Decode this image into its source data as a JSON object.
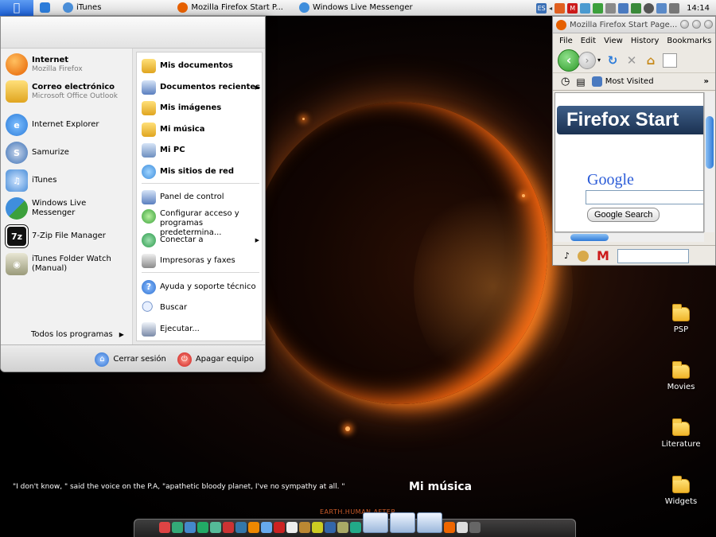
{
  "topbar": {
    "items": [
      {
        "label": "iTunes",
        "color": "#4a8ed8"
      },
      {
        "label": "Mozilla Firefox Start P...",
        "color": "#e66000"
      },
      {
        "label": "Windows Live Messenger",
        "color": "#3f8edc"
      }
    ],
    "tray_badges": [
      "ES",
      "M"
    ],
    "clock": "14:14"
  },
  "start_menu": {
    "pinned": [
      {
        "title": "Internet",
        "subtitle": "Mozilla Firefox",
        "icon": "firefox-icon",
        "color": "#e66000"
      },
      {
        "title": "Correo electrónico",
        "subtitle": "Microsoft Office Outlook",
        "icon": "outlook-icon",
        "color": "#e0a520"
      }
    ],
    "recent": [
      {
        "label": "Internet Explorer",
        "icon": "ie-icon",
        "color": "#2b7bd9"
      },
      {
        "label": "Samurize",
        "icon": "samurize-icon",
        "color": "#3a6fb5"
      },
      {
        "label": "iTunes",
        "icon": "itunes-icon",
        "color": "#4a8ed8"
      },
      {
        "label": "Windows Live Messenger",
        "icon": "messenger-icon",
        "color": "#3ca03c"
      },
      {
        "label": "7-Zip File Manager",
        "icon": "7zip-icon",
        "color": "#111111",
        "text": "7z"
      },
      {
        "label": "iTunes Folder Watch (Manual)",
        "icon": "folder-watch-icon",
        "color": "#9a9a7a"
      }
    ],
    "all_programs": "Todos los programas",
    "places": [
      {
        "label": "Mis documentos",
        "bold": true,
        "icon": "documents-folder-icon",
        "color": "#f0c040"
      },
      {
        "label": "Documentos recientes",
        "bold": true,
        "icon": "recent-documents-icon",
        "color": "#5a7fbf",
        "submenu": true
      },
      {
        "label": "Mis imágenes",
        "bold": true,
        "icon": "pictures-folder-icon",
        "color": "#f0c040"
      },
      {
        "label": "Mi música",
        "bold": true,
        "icon": "music-folder-icon",
        "color": "#f0c040"
      },
      {
        "label": "Mi PC",
        "bold": true,
        "icon": "computer-icon",
        "color": "#6d8fbf"
      },
      {
        "label": "Mis sitios de red",
        "bold": true,
        "icon": "network-icon",
        "color": "#3f8edc"
      },
      {
        "label": "Panel de control",
        "icon": "control-panel-icon",
        "color": "#5a7fbf"
      },
      {
        "label": "Configurar acceso y programas predetermina...",
        "icon": "default-programs-icon",
        "color": "#3aa23a"
      },
      {
        "label": "Conectar a",
        "icon": "connect-icon",
        "color": "#2a9a4a",
        "submenu": true
      },
      {
        "label": "Impresoras y faxes",
        "icon": "printer-icon",
        "color": "#8a8a8a"
      },
      {
        "label": "Ayuda y soporte técnico",
        "icon": "help-icon",
        "color": "#2b6fd0"
      },
      {
        "label": "Buscar",
        "icon": "search-icon",
        "color": "#5a7fbf"
      },
      {
        "label": "Ejecutar...",
        "icon": "run-icon",
        "color": "#7a8aa8"
      }
    ],
    "logoff_label": "Cerrar sesión",
    "shutdown_label": "Apagar equipo"
  },
  "firefox": {
    "title": "Mozilla Firefox Start Page...",
    "menus": [
      "File",
      "Edit",
      "View",
      "History",
      "Bookmarks"
    ],
    "bookmarks_label": "Most Visited",
    "banner": "Firefox Start",
    "google_logo": "Google",
    "search_button": "Google Search"
  },
  "desktop_icons": [
    "PSP",
    "Movies",
    "Literature",
    "Widgets"
  ],
  "quote": "\"I don't know, \" said the voice on the P.A, \"apathetic bloody planet, I've no sympathy at all. \"",
  "hover_label": "Mi música",
  "wallpaper_text": "EARTH.HUMAN.AFTER",
  "dock": {
    "icons": [
      "#d44",
      "#3a7",
      "#48c",
      "#2a6",
      "#5b9",
      "#c33",
      "#37a",
      "#e80",
      "#6ae",
      "#c22",
      "#eee",
      "#b83",
      "#cc2",
      "#36a",
      "#aa6",
      "#2a8",
      "#e60",
      "#ddd",
      "#666"
    ]
  }
}
